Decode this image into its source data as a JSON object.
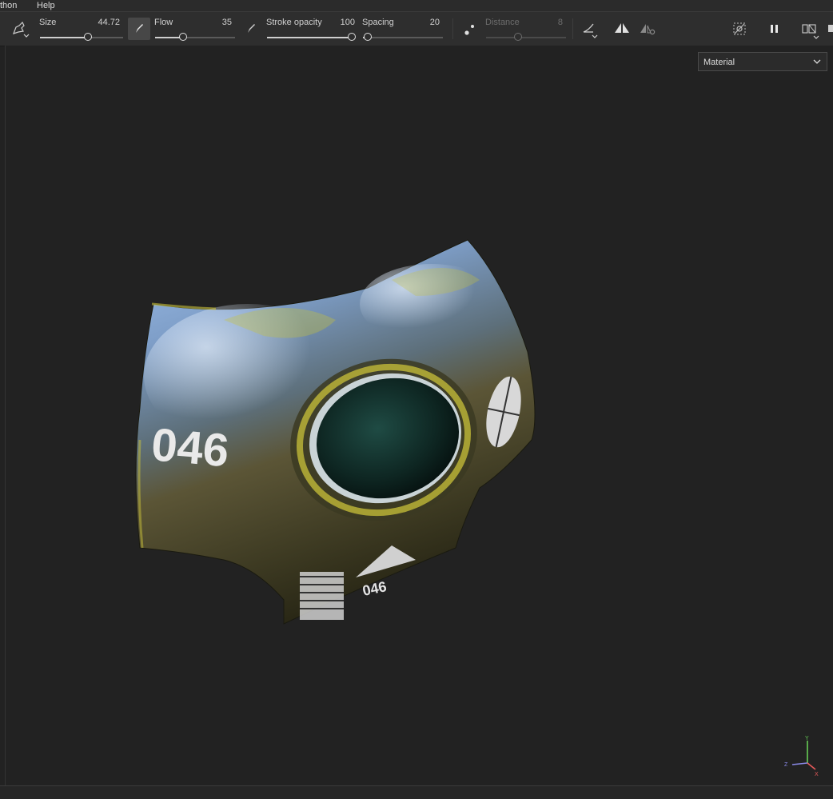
{
  "menu": {
    "items": [
      "thon",
      "Help"
    ]
  },
  "toolbar": {
    "size": {
      "label": "Size",
      "value": "44.72",
      "fraction": 0.58
    },
    "flow": {
      "label": "Flow",
      "value": "35",
      "fraction": 0.35
    },
    "stroke_opacity": {
      "label": "Stroke opacity",
      "value": "100",
      "fraction": 1.0
    },
    "spacing": {
      "label": "Spacing",
      "value": "20",
      "fraction": 0.06
    },
    "distance": {
      "label": "Distance",
      "value": "8",
      "fraction": 0.4,
      "disabled": true
    }
  },
  "viewport": {
    "channel_select": {
      "value": "Material"
    },
    "decal_text": "046",
    "decal_text_small": "046",
    "axis_labels": {
      "y": "Y",
      "z": "Z",
      "x": "X"
    }
  },
  "colors": {
    "background": "#222222",
    "toolbar": "#2e2e2e",
    "accent_yellow": "#c9c23a",
    "metal_blue": "#8fb0dc"
  }
}
